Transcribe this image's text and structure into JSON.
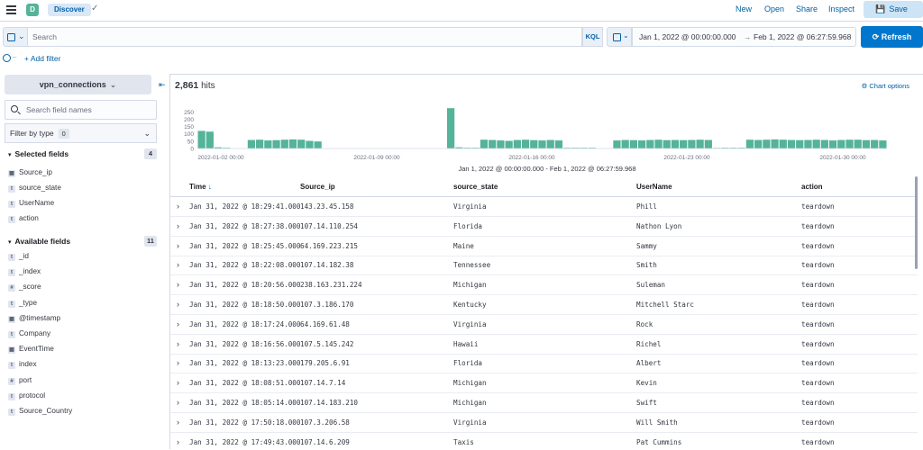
{
  "header": {
    "space_initial": "D",
    "breadcrumb": "Discover",
    "links": {
      "new": "New",
      "open": "Open",
      "share": "Share",
      "inspect": "Inspect"
    },
    "save": "Save"
  },
  "query": {
    "placeholder": "Search",
    "language": "KQL",
    "start": "Jan 1, 2022 @ 00:00:00.000",
    "arrow": "→",
    "end": "Feb 1, 2022 @ 06:27:59.968",
    "refresh": "Refresh"
  },
  "filters": {
    "add": "+ Add filter"
  },
  "sidebar": {
    "index_pattern": "vpn_connections",
    "field_search_placeholder": "Search field names",
    "filter_by_type": "Filter by type",
    "filter_count": "0",
    "selected_title": "Selected fields",
    "selected_count": "4",
    "selected": [
      {
        "type": "date",
        "name": "Source_ip"
      },
      {
        "type": "t",
        "name": "source_state"
      },
      {
        "type": "t",
        "name": "UserName"
      },
      {
        "type": "t",
        "name": "action"
      }
    ],
    "available_title": "Available fields",
    "available_count": "11",
    "available": [
      {
        "type": "t",
        "name": "_id"
      },
      {
        "type": "t",
        "name": "_index"
      },
      {
        "type": "#",
        "name": "_score"
      },
      {
        "type": "t",
        "name": "_type"
      },
      {
        "type": "date",
        "name": "@timestamp"
      },
      {
        "type": "t",
        "name": "Company"
      },
      {
        "type": "date",
        "name": "EventTime"
      },
      {
        "type": "t",
        "name": "index"
      },
      {
        "type": "#",
        "name": "port"
      },
      {
        "type": "t",
        "name": "protocol"
      },
      {
        "type": "t",
        "name": "Source_Country"
      }
    ]
  },
  "results": {
    "hits_count": "2,861",
    "hits_label": "hits",
    "chart_options": "Chart options",
    "range_caption": "Jan 1, 2022 @ 00:00:00.000 - Feb 1, 2022 @ 06:27:59.968",
    "columns": [
      "Time",
      "Source_ip",
      "source_state",
      "UserName",
      "action"
    ],
    "rows": [
      [
        "Jan 31, 2022 @ 18:29:41.000",
        "143.23.45.158",
        "Virginia",
        "Phill",
        "teardown"
      ],
      [
        "Jan 31, 2022 @ 18:27:38.000",
        "107.14.110.254",
        "Florida",
        "Nathon Lyon",
        "teardown"
      ],
      [
        "Jan 31, 2022 @ 18:25:45.000",
        "64.169.223.215",
        "Maine",
        "Sammy",
        "teardown"
      ],
      [
        "Jan 31, 2022 @ 18:22:08.000",
        "107.14.182.38",
        "Tennessee",
        "Smith",
        "teardown"
      ],
      [
        "Jan 31, 2022 @ 18:20:56.000",
        "238.163.231.224",
        "Michigan",
        "Suleman",
        "teardown"
      ],
      [
        "Jan 31, 2022 @ 18:18:50.000",
        "107.3.186.170",
        "Kentucky",
        "Mitchell Starc",
        "teardown"
      ],
      [
        "Jan 31, 2022 @ 18:17:24.000",
        "64.169.61.48",
        "Virginia",
        "Rock",
        "teardown"
      ],
      [
        "Jan 31, 2022 @ 18:16:56.000",
        "107.5.145.242",
        "Hawaii",
        "Richel",
        "teardown"
      ],
      [
        "Jan 31, 2022 @ 18:13:23.000",
        "179.205.6.91",
        "Florida",
        "Albert",
        "teardown"
      ],
      [
        "Jan 31, 2022 @ 18:08:51.000",
        "107.14.7.14",
        "Michigan",
        "Kevin",
        "teardown"
      ],
      [
        "Jan 31, 2022 @ 18:05:14.000",
        "107.14.183.210",
        "Michigan",
        "Swift",
        "teardown"
      ],
      [
        "Jan 31, 2022 @ 17:50:18.000",
        "107.3.206.58",
        "Virginia",
        "Will Smith",
        "teardown"
      ],
      [
        "Jan 31, 2022 @ 17:49:43.000",
        "107.14.6.209",
        "Taxis",
        "Pat Cummins",
        "teardown"
      ]
    ]
  },
  "colors": {
    "accent": "#0077cc",
    "bar": "#54b399"
  },
  "chart_data": {
    "type": "bar",
    "ylim": [
      0,
      270
    ],
    "yticks": [
      0,
      50,
      100,
      150,
      200,
      250
    ],
    "xticks": [
      "2022-01-02 00:00",
      "2022-01-09 00:00",
      "2022-01-16 00:00",
      "2022-01-23 00:00",
      "2022-01-30 00:00"
    ],
    "values": [
      120,
      115,
      8,
      5,
      0,
      0,
      58,
      60,
      55,
      57,
      60,
      62,
      60,
      52,
      48,
      0,
      0,
      0,
      0,
      0,
      0,
      0,
      0,
      0,
      0,
      0,
      0,
      0,
      0,
      0,
      275,
      8,
      5,
      5,
      60,
      58,
      55,
      52,
      58,
      60,
      57,
      55,
      58,
      55,
      5,
      5,
      5,
      5,
      0,
      0,
      55,
      58,
      57,
      55,
      58,
      60,
      57,
      58,
      57,
      58,
      60,
      58,
      4,
      5,
      5,
      5,
      60,
      58,
      60,
      62,
      60,
      58,
      57,
      58,
      60,
      58,
      55,
      58,
      60,
      60,
      57,
      58,
      55
    ]
  }
}
